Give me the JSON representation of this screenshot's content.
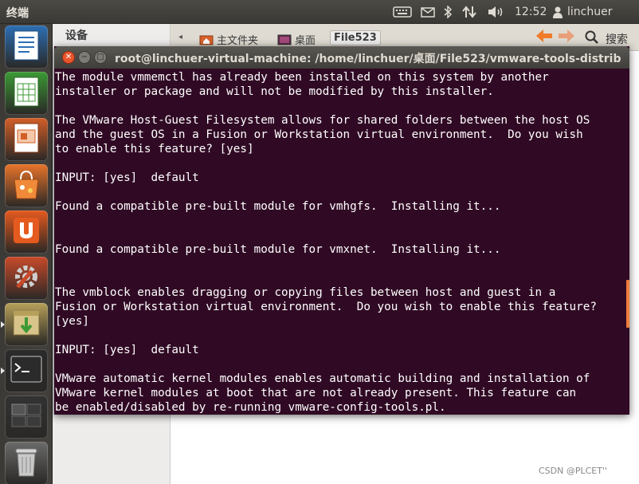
{
  "top_panel": {
    "title": "终端",
    "clock": "12:52",
    "user": "linchuer"
  },
  "launcher": {
    "items": [
      {
        "name": "LibreOffice Writer",
        "color": "#2c6fb5"
      },
      {
        "name": "LibreOffice Calc",
        "color": "#3c9a35"
      },
      {
        "name": "LibreOffice Impress",
        "color": "#d35f28"
      },
      {
        "name": "Ubuntu Software Center",
        "color": "#e8742a"
      },
      {
        "name": "Ubuntu One",
        "color": "#e55a1e"
      },
      {
        "name": "System Settings",
        "color": "#c84a2a"
      },
      {
        "name": "Archive Manager",
        "color": "#b7a05a"
      },
      {
        "name": "Terminal",
        "color": "#2b2b2b"
      },
      {
        "name": "Workspace Switcher",
        "color": "#333333"
      },
      {
        "name": "Trash",
        "color": "#6a6a6a"
      }
    ]
  },
  "file_manager": {
    "sidebar_heading": "设备",
    "breadcrumbs": [
      {
        "label": "主文件夹",
        "icon": "home-folder-icon"
      },
      {
        "label": "桌面",
        "icon": "desktop-icon"
      },
      {
        "label": "File523",
        "icon": "",
        "active": true
      }
    ],
    "search_label": "搜索"
  },
  "terminal": {
    "title": "root@linchuer-virtual-machine: /home/linchuer/桌面/File523/vmware-tools-distrib",
    "lines": [
      "The module vmmemctl has already been installed on this system by another",
      "installer or package and will not be modified by this installer.",
      "",
      "The VMware Host-Guest Filesystem allows for shared folders between the host OS",
      "and the guest OS in a Fusion or Workstation virtual environment.  Do you wish",
      "to enable this feature? [yes]",
      "",
      "INPUT: [yes]  default",
      "",
      "Found a compatible pre-built module for vmhgfs.  Installing it...",
      "",
      "",
      "Found a compatible pre-built module for vmxnet.  Installing it...",
      "",
      "",
      "The vmblock enables dragging or copying files between host and guest in a",
      "Fusion or Workstation virtual environment.  Do you wish to enable this feature?",
      "[yes]",
      "",
      "INPUT: [yes]  default",
      "",
      "VMware automatic kernel modules enables automatic building and installation of",
      "VMware kernel modules at boot that are not already present. This feature can",
      "be enabled/disabled by re-running vmware-config-tools.pl."
    ]
  },
  "watermark": "CSDN @PLCET''",
  "colors": {
    "terminal_bg": "#300a24",
    "close_button": "#e8552c",
    "scroll_thumb": "#ef7d3c"
  }
}
